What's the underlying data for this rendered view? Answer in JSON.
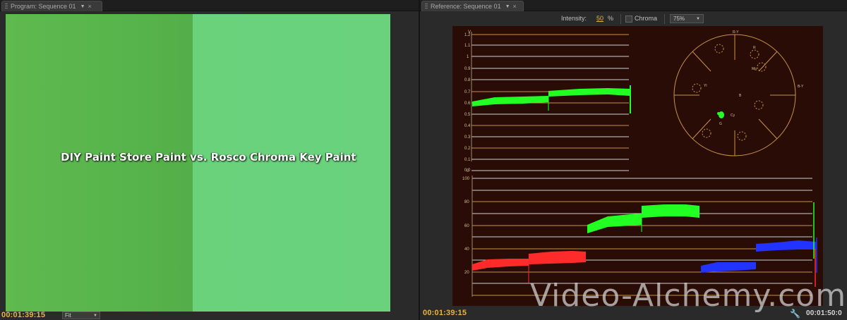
{
  "program_panel": {
    "tab_title": "Program: Sequence 01",
    "overlay_title": "DIY Paint Store Paint vs. Rosco Chroma Key Paint",
    "timecode": "00:01:39:15",
    "zoom_select": "Fit",
    "swatch_left_color": "#58b54c",
    "swatch_right_color": "#69d27c"
  },
  "reference_panel": {
    "tab_title": "Reference: Sequence 01",
    "intensity_label": "Intensity:",
    "intensity_value": "50",
    "intensity_unit": "%",
    "chroma_label": "Chroma",
    "zoom_select": "75%",
    "timecode_left": "00:01:39:15",
    "timecode_right": "00:01:50:0"
  },
  "scopes": {
    "waveform": {
      "y_ticks": [
        "1.2",
        "1.1",
        "1",
        "0.9",
        "0.8",
        "0.7",
        "0.6",
        "0.5",
        "0.4",
        "0.3",
        "0.2",
        "0.1",
        "0",
        "0.0"
      ],
      "y_unit": "V"
    },
    "vectorscope": {
      "labels": [
        "R-Y",
        "B-Y",
        "Yl",
        "R",
        "Mg",
        "B",
        "Cy",
        "G"
      ]
    },
    "rgb_parade": {
      "y_ticks": [
        "100",
        "80",
        "60",
        "40",
        "20"
      ]
    }
  },
  "watermark": "Video-Alchemy.com",
  "colors": {
    "timecode": "#e7b443",
    "scope_bg": "#2a0c06",
    "scope_line": "#c79340",
    "trace_green": "#22ff22",
    "trace_red": "#ff2a2a",
    "trace_blue": "#2233ff"
  },
  "icons": {
    "wrench": "wrench-icon",
    "panel_menu": "panel-menu-icon",
    "close": "close-icon"
  }
}
